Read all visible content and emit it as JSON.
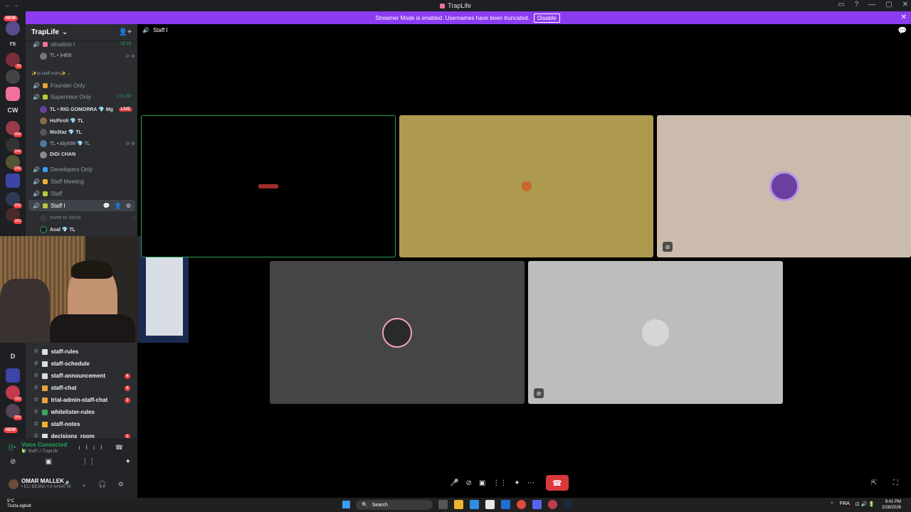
{
  "window": {
    "title": "TrapLife",
    "nav": "← →",
    "controls": [
      "▭",
      "?",
      "—",
      "▢",
      "✕"
    ]
  },
  "banner": {
    "text": "Streamer Mode is enabled. Usernames have been truncated.",
    "disable_label": "Disable",
    "close": "✕"
  },
  "rail": {
    "new_top": "NEW",
    "rs": "rs",
    "cw": "CW",
    "d": "D",
    "new_bottom": "NEW",
    "badges": [
      "34",
      "368",
      "144",
      "346",
      "292",
      "369",
      "116",
      "304"
    ]
  },
  "sidebar": {
    "guild_name": "TrapLife",
    "chevron": "⌄",
    "invite_icon": "👤+",
    "voice_channels": [
      {
        "name": "situation I",
        "timer": "28:19"
      },
      {
        "name": "Founder Only"
      },
      {
        "name": "Supervisor Only",
        "timer": "1:01:59"
      },
      {
        "name": "Developers Only"
      },
      {
        "name": "Staff Meeting"
      },
      {
        "name": "Staff"
      },
      {
        "name": "Staff I"
      }
    ],
    "category": "✨rp staff room✨ ⌄",
    "members": [
      {
        "name": "TL • IHEB",
        "tags": "⊘ ⊛"
      },
      {
        "name": "TL • RIG GOMORRA 💎 Mg",
        "live": "LIVE"
      },
      {
        "name": "HsPiroli 💎 TL"
      },
      {
        "name": "Mo3taz 💎 TL"
      },
      {
        "name": "TL • AlyX69 💎 TL",
        "tags": "⊘ ⊛"
      },
      {
        "name": "DiDi CHAN"
      },
      {
        "name": "Asal 💎 TL"
      }
    ],
    "active_actions": "💬 👤 ⚙",
    "invite_voice": "Invite to Voice",
    "invite_arrow": "›",
    "text_channels": [
      {
        "name": "staff-rules",
        "color": "#dbdee1"
      },
      {
        "name": "staff-schedule",
        "color": "#dbdee1"
      },
      {
        "name": "staff-announcement",
        "color": "#dbdee1",
        "badge": "4"
      },
      {
        "name": "staff-chat",
        "color": "#e8a23a",
        "badge": "4"
      },
      {
        "name": "trial-admin-staff-chat",
        "color": "#e8a23a",
        "badge": "2"
      },
      {
        "name": "whitelister-rules",
        "color": "#3ba55d"
      },
      {
        "name": "staff-notes",
        "color": "#f0b232"
      },
      {
        "name": "decisions_room",
        "color": "#dbdee1",
        "badge": "1"
      }
    ]
  },
  "voice_panel": {
    "status": "Voice Connected",
    "sub": "🔰 Staff I / TrapLife",
    "signal": "((•",
    "right_icons": "ılıl ☎",
    "buttons": [
      "⊘",
      "▣",
      "⋮⋮",
      "✦"
    ],
    "user_name": "OMAR MALLEK",
    "user_sub": "• ELI BE3NA Y.II NHAR W",
    "user_controls": "🎤 ⌄ 🎧 ⚙"
  },
  "call": {
    "channel_name": "Staff I",
    "chat_icon": "💬",
    "tile_mute_icon": "⊘",
    "controls": {
      "mic": "🎤",
      "cam": "⊘",
      "share": "▣",
      "activity": "⋮⋮",
      "soundboard": "✦",
      "more": "⋯",
      "end": "☎"
    },
    "right_icons": "⇱ ⛶"
  },
  "taskbar": {
    "weather_temp": "5°C",
    "weather_desc": "Tiszta égbolt",
    "search_label": "Search",
    "search_icon": "🔍",
    "tray": [
      "⌃",
      "FRA",
      "⊡ 🔊 🔋"
    ],
    "time": "9:41 PM",
    "date": "2/28/2026"
  },
  "colors": {
    "accent": "#8b3cf0",
    "live": "#da373c",
    "connected": "#23a55a"
  }
}
